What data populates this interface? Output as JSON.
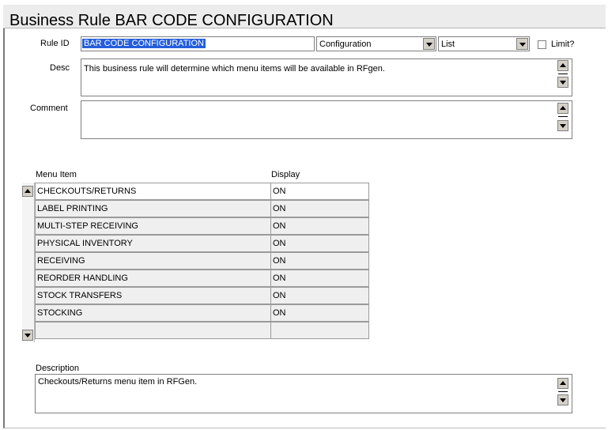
{
  "header": {
    "title": "Business Rule BAR CODE CONFIGURATION"
  },
  "form": {
    "rule_id_label": "Rule ID",
    "rule_id_value": "BAR CODE CONFIGURATION",
    "type_select": "Configuration",
    "mode_select": "List",
    "limit_label": "Limit?",
    "limit_checked": false,
    "desc_label": "Desc",
    "desc_value": "This business rule will determine which menu items will be available in RFgen.",
    "comment_label": "Comment",
    "comment_value": ""
  },
  "grid": {
    "columns": [
      "Menu Item",
      "Display"
    ],
    "rows": [
      {
        "item": "CHECKOUTS/RETURNS",
        "display": "ON"
      },
      {
        "item": "LABEL PRINTING",
        "display": "ON"
      },
      {
        "item": "MULTI-STEP RECEIVING",
        "display": "ON"
      },
      {
        "item": "PHYSICAL INVENTORY",
        "display": "ON"
      },
      {
        "item": "RECEIVING",
        "display": "ON"
      },
      {
        "item": "REORDER HANDLING",
        "display": "ON"
      },
      {
        "item": "STOCK TRANSFERS",
        "display": "ON"
      },
      {
        "item": "STOCKING",
        "display": "ON"
      },
      {
        "item": "",
        "display": ""
      }
    ]
  },
  "description": {
    "label": "Description",
    "value": "Checkouts/Returns menu item in RFGen."
  },
  "colors": {
    "selection": "#245edb",
    "title_bar": "#ececec",
    "button_face": "#d4d0c8"
  }
}
